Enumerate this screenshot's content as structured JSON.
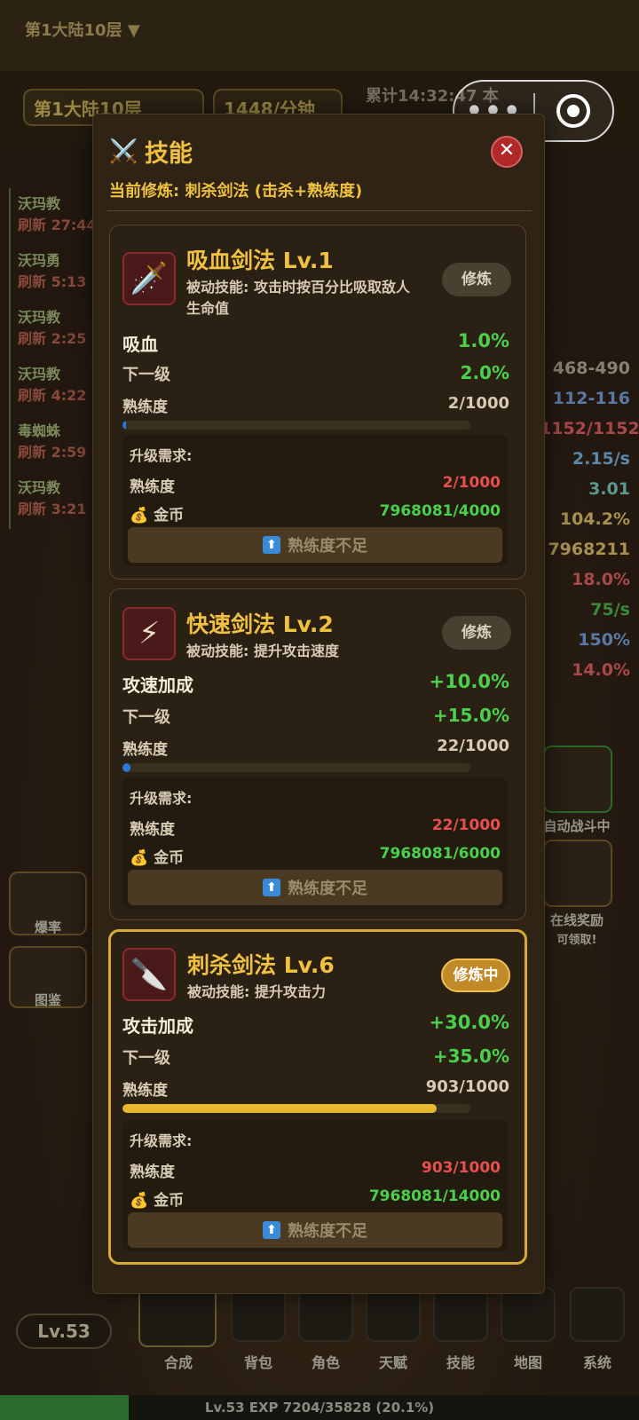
{
  "background": {
    "floor_top": "第1大陆10层 ▼",
    "floor_chip": "第1大陆10层",
    "rate_chip": "1448/分钟",
    "session": "累计14:32:47 本",
    "left_list": [
      {
        "name": "沃玛教",
        "timer": "刷新 27:44"
      },
      {
        "name": "沃玛勇",
        "timer": "刷新 5:13"
      },
      {
        "name": "沃玛教",
        "timer": "刷新 2:25"
      },
      {
        "name": "沃玛教",
        "timer": "刷新 4:22"
      },
      {
        "name": "毒蜘蛛",
        "timer": "刷新 2:59"
      },
      {
        "name": "沃玛教",
        "timer": "刷新 3:21"
      }
    ],
    "right_stats": [
      "468-490",
      "112-116",
      "1152/1152",
      "2.15/s",
      "3.01",
      "104.2%",
      "7968211",
      "18.0%",
      "75/s",
      "150%",
      "14.0%"
    ],
    "auto_battle": "自动战斗中",
    "online_reward": "在线奖励",
    "online_reward_sub": "可领取!",
    "drop_rate": "爆率",
    "codex": "图鉴"
  },
  "capsule": {
    "more": "•••"
  },
  "modal": {
    "icon": "crossed-swords-icon",
    "title": "技能",
    "close": "✕",
    "current": "当前修炼: 刺杀剑法 (击杀+熟练度)"
  },
  "skills": [
    {
      "name": "吸血剑法 Lv.1",
      "desc": "被动技能: 攻击时按百分比吸取敌人生命值",
      "button": "修炼",
      "stat_label": "吸血",
      "stat_value": "1.0%",
      "next_label": "下一级",
      "next_value": "2.0%",
      "prof_label": "熟练度",
      "prof_value": "2/1000",
      "progress": 0.002,
      "req_title": "升级需求:",
      "req_prof_label": "熟练度",
      "req_prof_value": "2/1000",
      "req_gold_label": "金币",
      "req_gold_value": "7968081/4000",
      "req_button": "熟练度不足"
    },
    {
      "name": "快速剑法 Lv.2",
      "desc": "被动技能: 提升攻击速度",
      "button": "修炼",
      "stat_label": "攻速加成",
      "stat_value": "+10.0%",
      "next_label": "下一级",
      "next_value": "+15.0%",
      "prof_label": "熟练度",
      "prof_value": "22/1000",
      "progress": 0.022,
      "req_title": "升级需求:",
      "req_prof_label": "熟练度",
      "req_prof_value": "22/1000",
      "req_gold_label": "金币",
      "req_gold_value": "7968081/6000",
      "req_button": "熟练度不足"
    },
    {
      "name": "刺杀剑法 Lv.6",
      "desc": "被动技能: 提升攻击力",
      "button": "修炼中",
      "stat_label": "攻击加成",
      "stat_value": "+30.0%",
      "next_label": "下一级",
      "next_value": "+35.0%",
      "prof_label": "熟练度",
      "prof_value": "903/1000",
      "progress": 0.903,
      "req_title": "升级需求:",
      "req_prof_label": "熟练度",
      "req_prof_value": "903/1000",
      "req_gold_label": "金币",
      "req_gold_value": "7968081/14000",
      "req_button": "熟练度不足"
    }
  ],
  "bottom_nav": {
    "level": "Lv.53",
    "items": [
      "合成",
      "背包",
      "角色",
      "天赋",
      "技能",
      "地图",
      "系统"
    ]
  },
  "exp": {
    "text": "Lv.53  EXP 7204/35828 (20.1%)",
    "progress": 0.201
  },
  "colors": {
    "gold": "#f0c040",
    "green": "#4ad04a",
    "red": "#e85050",
    "accent_border": "#d8a838"
  }
}
